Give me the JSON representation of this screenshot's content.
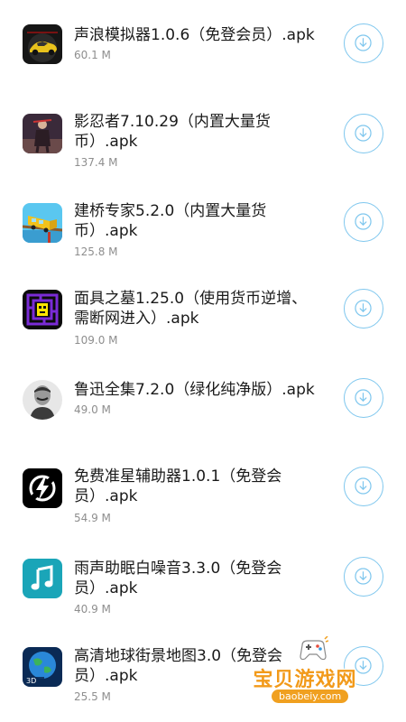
{
  "apps": [
    {
      "title": "声浪模拟器1.0.6（免登会员）.apk",
      "size": "60.1 M",
      "icon": "race-car-icon"
    },
    {
      "title": "影忍者7.10.29（内置大量货\n币）.apk",
      "size": "137.4 M",
      "icon": "ninja-icon"
    },
    {
      "title": "建桥专家5.2.0（内置大量货\n币）.apk",
      "size": "125.8 M",
      "icon": "bridge-bus-icon"
    },
    {
      "title": "面具之墓1.25.0（使用货币逆增、\n需断网进入）.apk",
      "size": "109.0 M",
      "icon": "tomb-mask-icon"
    },
    {
      "title": "鲁迅全集7.2.0（绿化纯净版）.apk",
      "size": "49.0 M",
      "icon": "portrait-icon"
    },
    {
      "title": "免费准星辅助器1.0.1（免登会\n员）.apk",
      "size": "54.9 M",
      "icon": "crosshair-lightning-icon"
    },
    {
      "title": "雨声助眠白噪音3.3.0（免登会\n员）.apk",
      "size": "40.9 M",
      "icon": "music-note-icon"
    },
    {
      "title": "高清地球街景地图3.0（免登会\n员）.apk",
      "size": "25.5 M",
      "icon": "earth-3d-icon"
    }
  ],
  "download_icon": "arrow-down-icon",
  "watermark": {
    "logo_text": "宝贝游戏网",
    "url": "baobeiy.com"
  },
  "colors": {
    "accent": "#7fc7ee",
    "title": "#1a1a1a",
    "size": "#8e8e8e",
    "watermark": "#f29a1a"
  }
}
